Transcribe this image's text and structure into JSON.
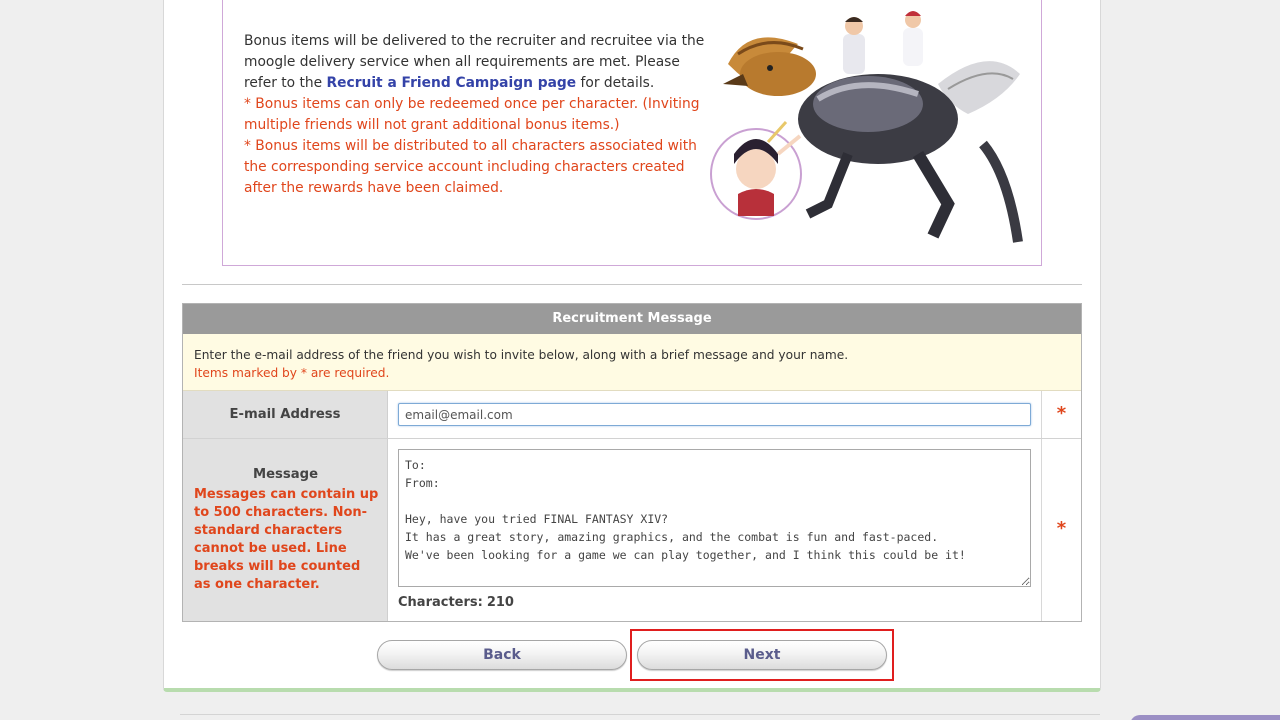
{
  "info": {
    "line1": "Bonus items will be delivered to the recruiter and recruitee via the moogle delivery service when all requirements are met.",
    "refer_prefix": "Please refer to the ",
    "refer_link": "Recruit a Friend Campaign page",
    "refer_suffix": " for details.",
    "note1": "* Bonus items can only be redeemed once per character. (Inviting multiple friends will not grant additional bonus items.)",
    "note2": "* Bonus items will be distributed to all characters associated with the corresponding service account including characters created after the rewards have been claimed."
  },
  "form": {
    "header": "Recruitment Message",
    "intro": "Enter the e-mail address of the friend you wish to invite below, along with a brief message and your name.",
    "required_note": "Items marked by * are required.",
    "email_label": "E-mail Address",
    "email_value": "email@email.com",
    "required_mark": "*",
    "message_label": "Message",
    "message_note": "Messages can contain up to 500 characters. Non-standard characters cannot be used. Line breaks will be counted as one character.",
    "message_value": "To:\nFrom:\n\nHey, have you tried FINAL FANTASY XIV?\nIt has a great story, amazing graphics, and the combat is fun and fast-paced.\nWe've been looking for a game we can play together, and I think this could be it!",
    "char_label": "Characters:",
    "char_count": "210"
  },
  "buttons": {
    "back": "Back",
    "next": "Next"
  },
  "colors": {
    "accent_red": "#e0461c",
    "link_blue": "#3443a8",
    "header_gray": "#9a9a9a",
    "highlight_red": "#e01e1e"
  }
}
